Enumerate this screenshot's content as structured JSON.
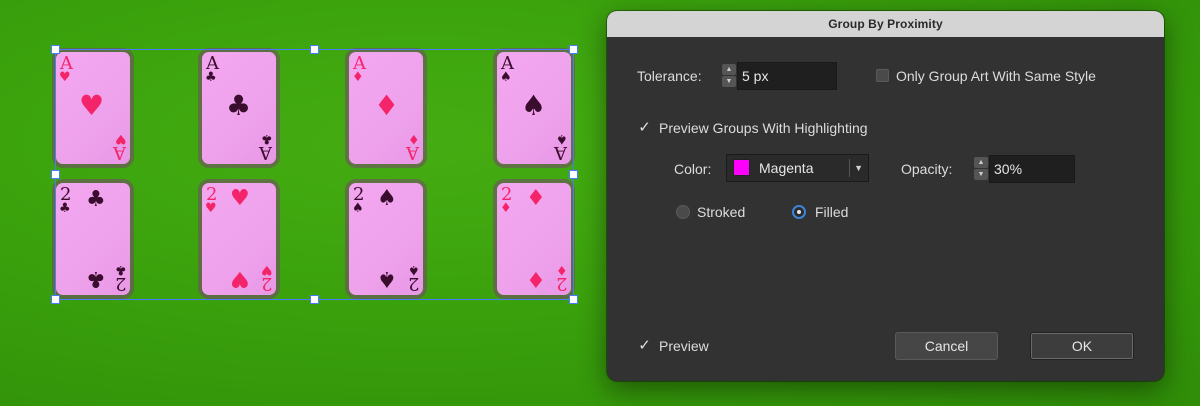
{
  "canvas": {
    "cards": [
      {
        "id": "ace-hearts",
        "rank": "A",
        "suit": "♥",
        "color": "red"
      },
      {
        "id": "ace-clubs",
        "rank": "A",
        "suit": "♣",
        "color": "dark"
      },
      {
        "id": "ace-diamonds",
        "rank": "A",
        "suit": "♦",
        "color": "red"
      },
      {
        "id": "ace-spades",
        "rank": "A",
        "suit": "♠",
        "color": "dark"
      },
      {
        "id": "two-clubs",
        "rank": "2",
        "suit": "♣",
        "color": "dark"
      },
      {
        "id": "two-hearts",
        "rank": "2",
        "suit": "♥",
        "color": "red"
      },
      {
        "id": "two-spades",
        "rank": "2",
        "suit": "♠",
        "color": "dark"
      },
      {
        "id": "two-diamonds",
        "rank": "2",
        "suit": "♦",
        "color": "red"
      }
    ]
  },
  "dialog": {
    "title": "Group By Proximity",
    "tolerance_label": "Tolerance:",
    "tolerance_value": "5 px",
    "same_style_label": "Only Group Art With Same Style",
    "same_style_checked": false,
    "preview_groups_label": "Preview Groups With Highlighting",
    "preview_groups_checked": true,
    "color_label": "Color:",
    "color_value": "Magenta",
    "color_swatch": "#ff00ff",
    "opacity_label": "Opacity:",
    "opacity_value": "30%",
    "stroked_label": "Stroked",
    "filled_label": "Filled",
    "highlight_mode": "Filled",
    "preview_label": "Preview",
    "preview_checked": true,
    "cancel_label": "Cancel",
    "ok_label": "OK"
  },
  "colors": {
    "canvas_green": "#3aa10c",
    "card_pink": "#f3a7f0",
    "red_suit": "#f4246a",
    "dark_suit": "#3a0c2e",
    "selection_blue": "#4b7bff",
    "dialog_bg": "#323232"
  }
}
